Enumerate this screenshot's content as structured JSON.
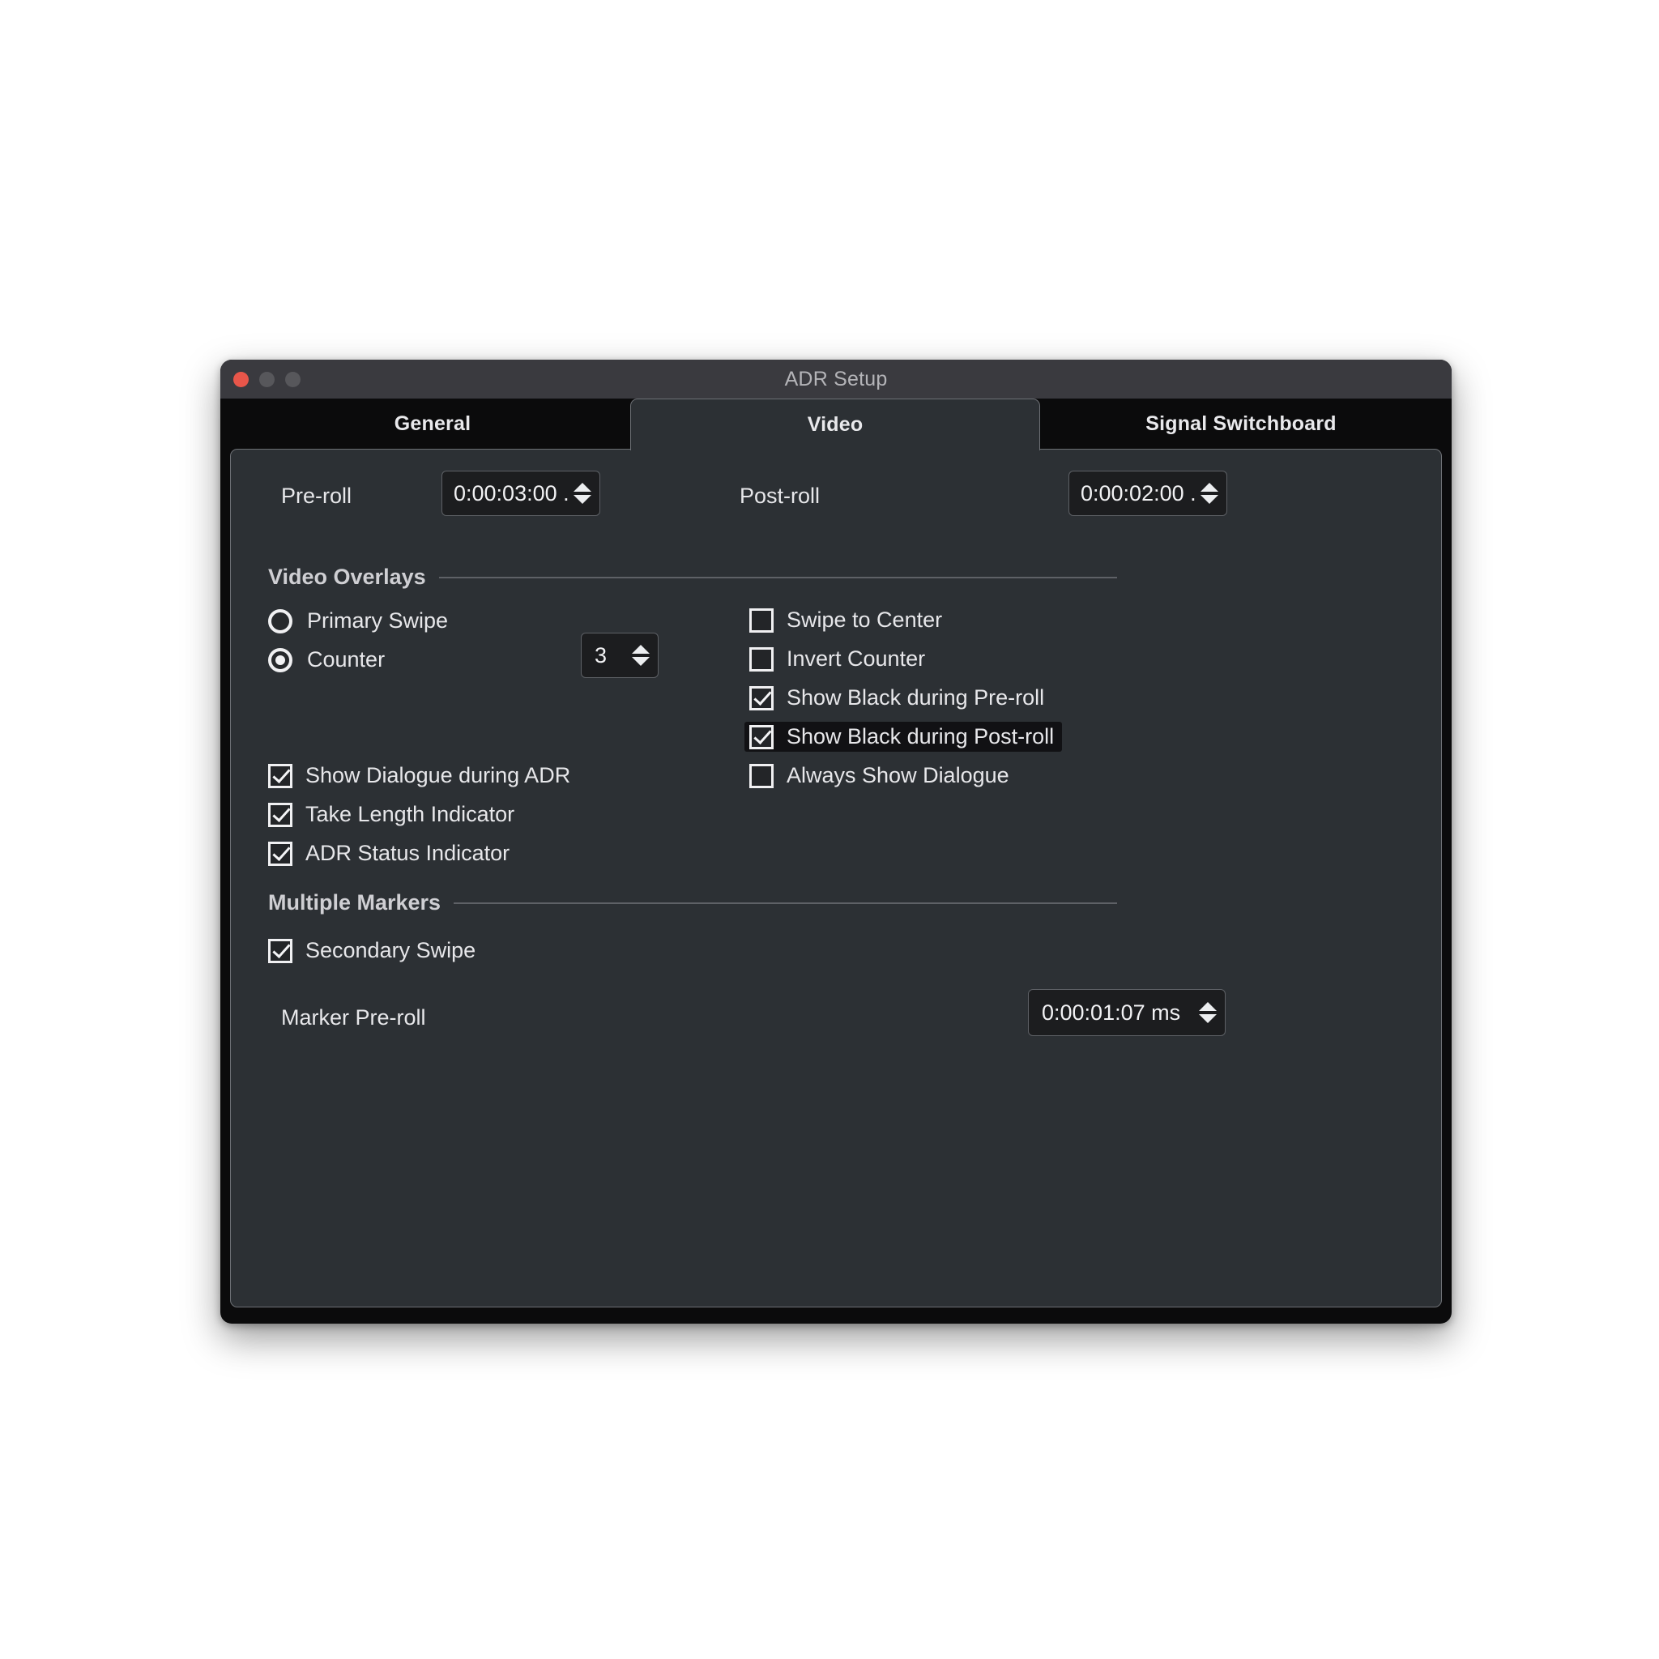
{
  "window": {
    "title": "ADR Setup",
    "traffic_lights": [
      {
        "name": "close",
        "color": "#e8564a"
      },
      {
        "name": "minimize",
        "color": "#57575b"
      },
      {
        "name": "zoom",
        "color": "#57575b"
      }
    ]
  },
  "tabs": [
    {
      "label": "General",
      "active": false
    },
    {
      "label": "Video",
      "active": true
    },
    {
      "label": "Signal Switchboard",
      "active": false
    }
  ],
  "timecodes": {
    "preroll_label": "Pre-roll",
    "preroll_value": "0:00:03:00 .",
    "postroll_label": "Post-roll",
    "postroll_value": "0:00:02:00 ."
  },
  "video_overlays": {
    "title": "Video Overlays",
    "radios": [
      {
        "label": "Primary Swipe",
        "selected": false
      },
      {
        "label": "Counter",
        "selected": true
      }
    ],
    "counter_value": "3",
    "left_checkboxes": [
      {
        "label": "Show Dialogue during ADR",
        "checked": true,
        "highlighted": false
      },
      {
        "label": "Take Length Indicator",
        "checked": true,
        "highlighted": false
      },
      {
        "label": "ADR Status Indicator",
        "checked": true,
        "highlighted": false
      }
    ],
    "right_checkboxes": [
      {
        "label": "Swipe to Center",
        "checked": false,
        "highlighted": false
      },
      {
        "label": "Invert Counter",
        "checked": false,
        "highlighted": false
      },
      {
        "label": "Show Black during Pre-roll",
        "checked": true,
        "highlighted": false
      },
      {
        "label": "Show Black during Post-roll",
        "checked": true,
        "highlighted": true
      },
      {
        "label": "Always Show Dialogue",
        "checked": false,
        "highlighted": false
      }
    ]
  },
  "multiple_markers": {
    "title": "Multiple Markers",
    "secondary_swipe_label": "Secondary Swipe",
    "secondary_swipe_checked": true,
    "marker_preroll_label": "Marker Pre-roll",
    "marker_preroll_value": "0:00:01:07 ms"
  },
  "icons": {
    "stepper_up": "arrow-up-icon",
    "stepper_down": "arrow-down-icon"
  },
  "colors": {
    "window_chrome": "#3a3a3f",
    "tabbar_bg": "#0b0b0c",
    "panel_bg": "#2c3034",
    "panel_border": "#6d7075",
    "field_bg": "#1c1d1f",
    "text": "#e7e7ea",
    "title_text": "#b4b4b8",
    "highlight_bg": "#111114",
    "close_red": "#e8564a"
  }
}
